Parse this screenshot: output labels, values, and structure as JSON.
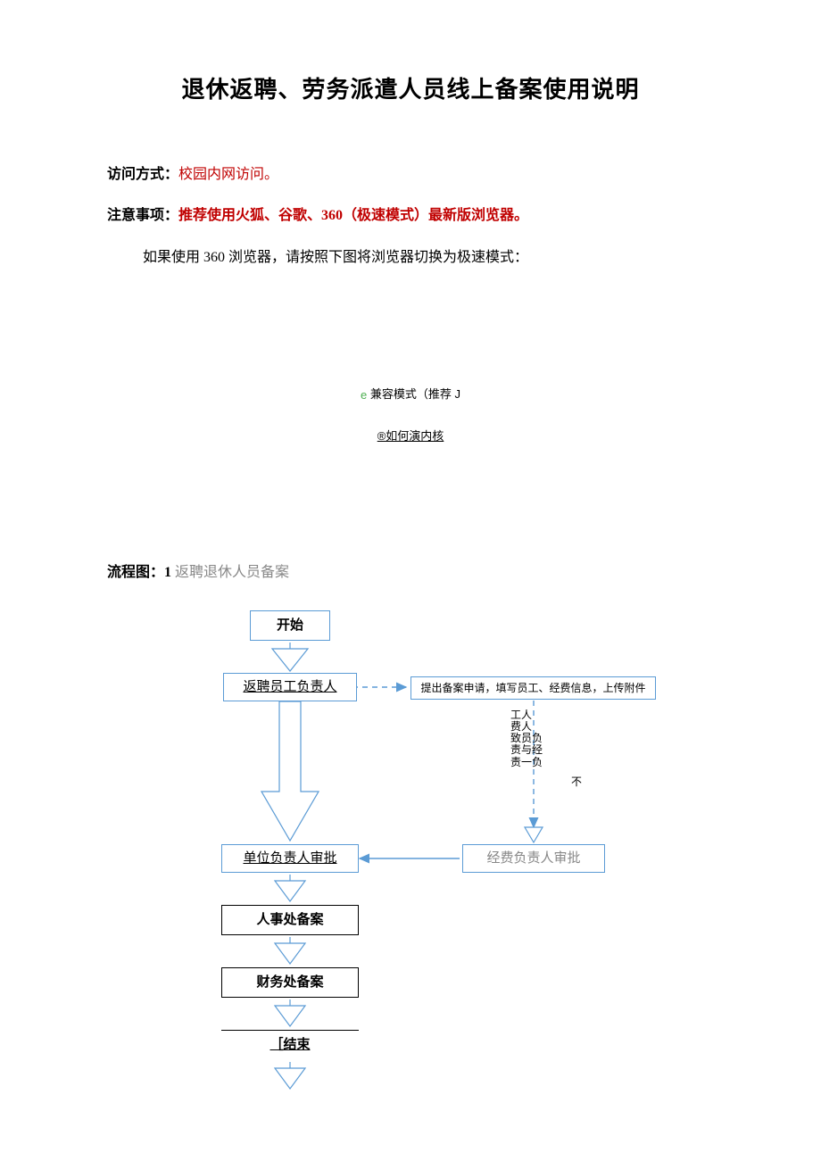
{
  "title": "退休返聘、劳务派遣人员线上备案使用说明",
  "access_label": "访问方式：",
  "access_value": "校园内网访问。",
  "notice_label": "注意事项：",
  "notice_value": "推荐使用火狐、谷歌、360（极速模式）最新版浏览器。",
  "notice_extra": "如果使用 360 浏览器，请按照下图将浏览器切换为极速模式：",
  "mode_compat_prefix": "e",
  "mode_compat": "兼容模式（推荐 J",
  "mode_kernel": "®如何演内核",
  "flow_label_strong": "流程图：1",
  "flow_label_rest": " 返聘退休人员备案",
  "flow": {
    "start": "开始",
    "responsible": "返聘员工负责人",
    "submit": "提出备案申请，填写员工、经费信息，上传附件",
    "cond_col1": "工费致责责",
    "cond_col2": "人人员与一",
    "cond_col3": "负\n经\n负",
    "cond_word": "不",
    "fund_approve": "经费负责人审批",
    "unit_approve": "单位负责人审批",
    "hr_record": "人事处备案",
    "finance_record": "财务处备案",
    "end": "［结束"
  }
}
